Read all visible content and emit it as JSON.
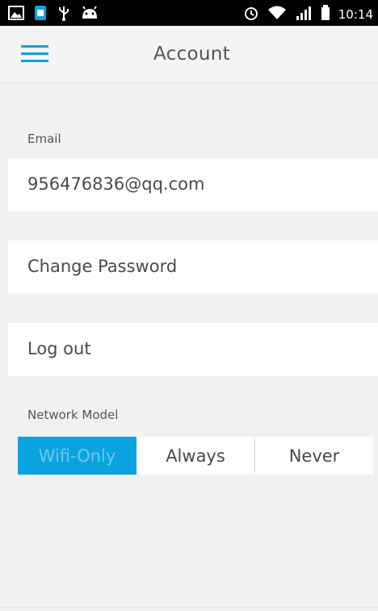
{
  "status_bar": {
    "time": "10:14",
    "icons_left": [
      "image-icon",
      "sim-card-icon",
      "usb-icon",
      "android-icon"
    ],
    "icons_right": [
      "alarm-icon",
      "wifi-icon",
      "signal-icon",
      "battery-icon"
    ]
  },
  "app_bar": {
    "title": "Account",
    "menu_icon": "hamburger-menu-icon"
  },
  "account": {
    "email_label": "Email",
    "email_value": "956476836@qq.com",
    "change_password": "Change Password",
    "log_out": "Log out"
  },
  "network": {
    "label": "Network Model",
    "options": [
      "Wifi-Only",
      "Always",
      "Never"
    ],
    "selected": "Wifi-Only"
  },
  "colors": {
    "accent": "#0aa3e0",
    "background": "#f1f1f1",
    "status_bar": "#000000"
  }
}
